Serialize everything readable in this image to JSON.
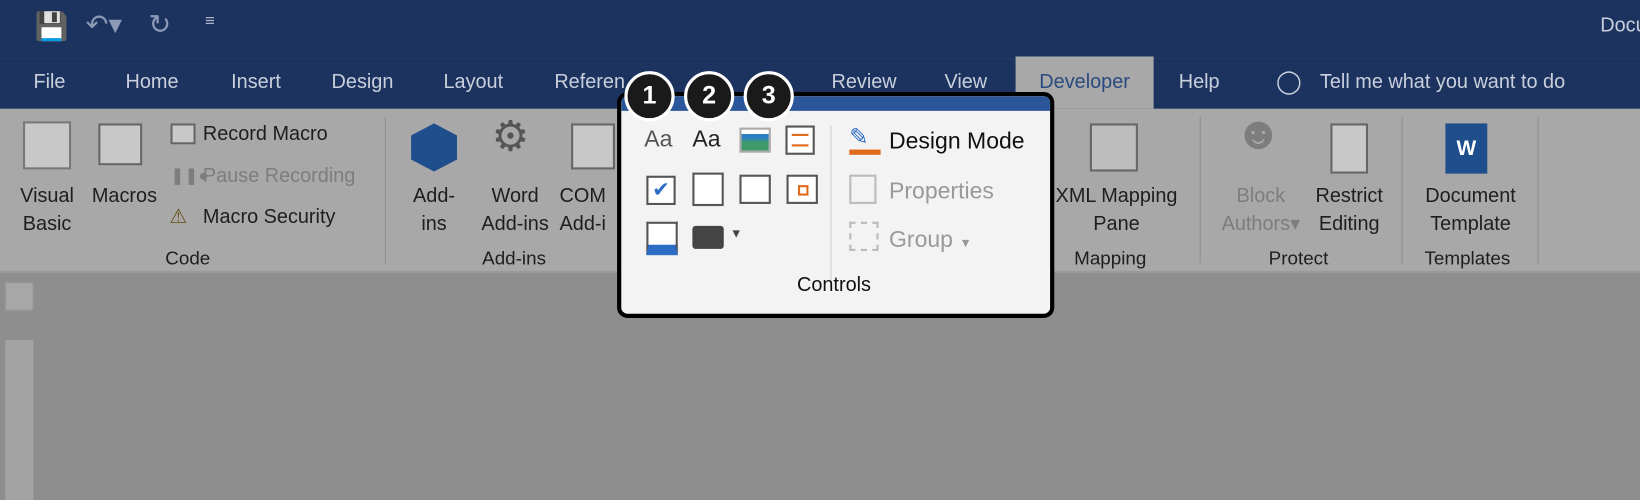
{
  "window": {
    "title": "Docu"
  },
  "quick_access": {
    "save": "save-icon",
    "undo": "undo-icon",
    "redo": "redo-icon",
    "customize": "customize-icon"
  },
  "tabs": [
    "File",
    "Home",
    "Insert",
    "Design",
    "Layout",
    "Referen",
    "Review",
    "View",
    "Developer",
    "Help"
  ],
  "active_tab": "Developer",
  "tell_me": "Tell me what you want to do",
  "code": {
    "visual_basic": [
      "Visual",
      "Basic"
    ],
    "macros": "Macros",
    "record": "Record Macro",
    "pause": "Pause Recording",
    "security": "Macro Security",
    "label": "Code"
  },
  "addins": {
    "addins": [
      "Add-",
      "ins"
    ],
    "word": [
      "Word",
      "Add-ins"
    ],
    "com": [
      "COM",
      "Add-i"
    ],
    "label": "Add-ins"
  },
  "controls": {
    "design_mode": "Design Mode",
    "properties": "Properties",
    "group": "Group",
    "label": "Controls",
    "aa1": "Aa",
    "aa2": "Aa"
  },
  "mapping": {
    "xml": [
      "XML Mapping",
      "Pane"
    ],
    "label": "Mapping"
  },
  "protect": {
    "block": [
      "Block",
      "Authors"
    ],
    "restrict": [
      "Restrict",
      "Editing"
    ],
    "label": "Protect"
  },
  "templates": {
    "doc": [
      "Document",
      "Template"
    ],
    "label": "Templates"
  },
  "badges": [
    "1",
    "2",
    "3"
  ],
  "colors": {
    "title_bar": "#1c3360",
    "accent": "#2b579a",
    "badge": "#1a1a1a"
  }
}
